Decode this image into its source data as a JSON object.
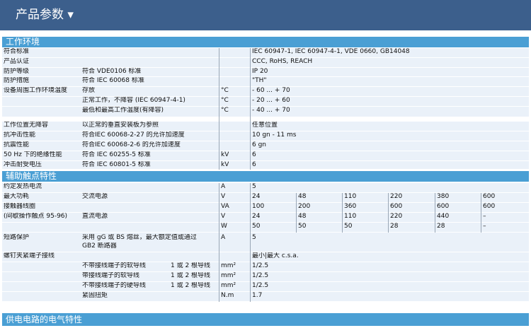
{
  "header": {
    "title": "产品参数 ▾"
  },
  "sections": {
    "env": "工作环境",
    "aux": "辅助触点特性",
    "power": "供电电路的电气特性"
  },
  "env": {
    "std_label": "符合标准",
    "std_value": "IEC 60947-1, IEC 60947-4-1, VDE 0660, GB14048",
    "cert_label": "产品认证",
    "cert_value": "CCC, RoHS, REACH",
    "ip_label": "防护等级",
    "ip_desc": "符合 VDE0106 标准",
    "ip_value": "IP 20",
    "treat_label": "防护措施",
    "treat_desc": "符合 IEC 60068 标准",
    "treat_value": "\"TH\"",
    "temp_label": "设备周围工作环境温度",
    "temp_store": "存放",
    "temp_unit": "°C",
    "temp_store_val": "- 60 ... + 70",
    "temp_normal": "正常工作，不降容 (IEC 60947-4-1)",
    "temp_normal_val": "- 20 ... + 60",
    "temp_derate": "最低和最高工作温度(有降容)",
    "temp_derate_val": "- 40 ... + 70",
    "pos_label": "工作位置无降容",
    "pos_desc": "以正常的垂直安装板为参照",
    "pos_value": "任意位置",
    "shock_label": "抗冲击性能",
    "shock_desc": "符合IEC 60068-2-27 的允许加速度",
    "shock_value": "10 gn - 11 ms",
    "vib_label": "抗震性能",
    "vib_desc": "符合IEC 60068-2-6 的允许加速度",
    "vib_value": "6 gn",
    "diel_label": "50 Hz 下的绝缘性能",
    "diel_desc": "符合 IEC 60255-5 标准",
    "diel_unit": "kV",
    "diel_value": "6",
    "surge_label": "冲击耐受电压",
    "surge_desc": "符合 IEC 60801-5 标准",
    "surge_unit": "kV",
    "surge_value": "6"
  },
  "aux": {
    "ith_label": "约定发热电流",
    "ith_unit": "A",
    "ith_value": "5",
    "maxp_label1": "最大功耗",
    "maxp_label2": "接触器线圈",
    "maxp_label3": "(间歇操作触点 95-96)",
    "ac_label": "交流电源",
    "ac_v": [
      "24",
      "48",
      "110",
      "220",
      "380",
      "600"
    ],
    "ac_va": [
      "100",
      "200",
      "360",
      "600",
      "600",
      "600"
    ],
    "dc_label": "直流电源",
    "dc_v": [
      "24",
      "48",
      "110",
      "220",
      "440",
      "–"
    ],
    "dc_w": [
      "50",
      "50",
      "50",
      "28",
      "28",
      "–"
    ],
    "u_v": "V",
    "u_va": "VA",
    "u_w": "W",
    "sc_label": "短路保护",
    "sc_desc1": "采用 gG 或 BS 熔丝，最大额定值或通过",
    "sc_desc2": "GB2 断路器",
    "sc_unit": "A",
    "sc_value": "5",
    "term_label": "螺钉夹紧端子接线",
    "term_head": "最小|最大 c.s.a.",
    "t_flex": "不带接线端子的软导线",
    "t_flex_end": "带接线端子的软导线",
    "t_solid": "不带接线端子的硬导线",
    "t_count": "1 或 2 根导线",
    "t_unit": "mm²",
    "t_val": "1/2.5",
    "torque_label": "紧固扭矩",
    "torque_unit": "N.m",
    "torque_val": "1.7"
  }
}
